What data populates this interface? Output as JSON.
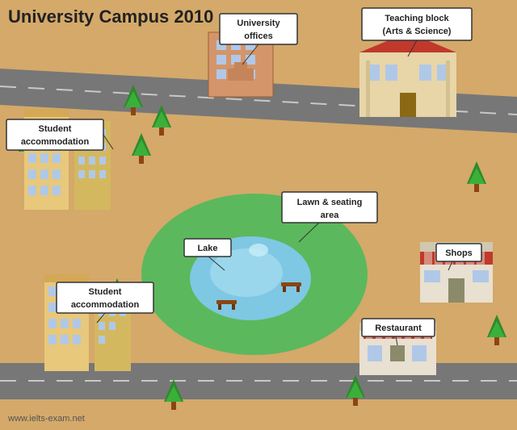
{
  "title": "University Campus 2010",
  "website": "www.ielts-exam.net",
  "labels": {
    "university_offices": "University\noffices",
    "teaching_block": "Teaching block\n(Arts & Science)",
    "student_accommodation_top": "Student\naccommodation",
    "student_accommodation_bottom": "Student\naccommodation",
    "lawn_seating": "Lawn & seating\narea",
    "lake": "Lake",
    "shops": "Shops",
    "restaurant": "Restaurant"
  },
  "colors": {
    "background": "#d4a96a",
    "road": "#666666",
    "grass": "#5cb85c",
    "lake": "#a8d8ea",
    "building_red": "#c0392b",
    "building_tan": "#d4a86a",
    "tree_dark": "#2d8a2d",
    "tree_light": "#3ab03a",
    "label_bg": "#ffffff",
    "label_border": "#333333"
  }
}
